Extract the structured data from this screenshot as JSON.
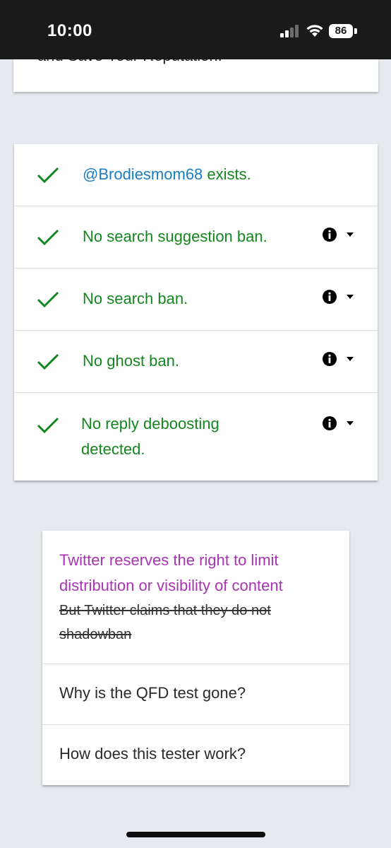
{
  "status_bar": {
    "time": "10:00",
    "battery_level": "86",
    "icons": [
      "signal-icon",
      "wifi-icon",
      "battery-icon"
    ]
  },
  "top_card": {
    "partial_text": "and Save Your Reputation."
  },
  "results": {
    "handle": "@Brodiesmom68",
    "exists_suffix": " exists.",
    "items": [
      {
        "label": "No search suggestion ban."
      },
      {
        "label": "No search ban."
      },
      {
        "label": "No ghost ban."
      },
      {
        "label": "No reply deboosting detected."
      }
    ],
    "colors": {
      "ok_green": "#14861e",
      "handle_blue": "#1a7dc4"
    }
  },
  "info_card": {
    "limit_notice": "Twitter reserves the right to limit distribution or visibility of content",
    "claim_notice": "But Twitter claims that they do not shadowban",
    "faq": [
      {
        "question": "Why is the QFD test gone?"
      },
      {
        "question": "How does this tester work?"
      }
    ],
    "colors": {
      "notice_purple": "#a933b5"
    }
  }
}
